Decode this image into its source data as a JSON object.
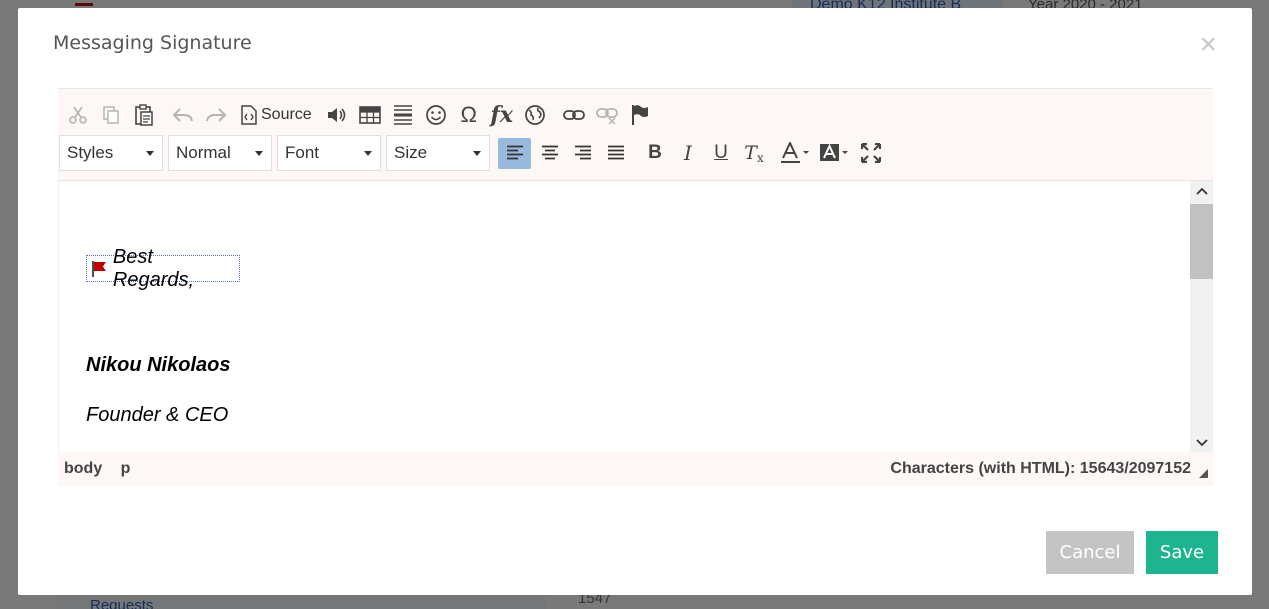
{
  "background": {
    "institute": "Demo K12 Institute B",
    "year": "Year 2020 - 2021",
    "sidebar_item": "Requests",
    "number": "1547"
  },
  "modal": {
    "title": "Messaging Signature",
    "close_symbol": "×"
  },
  "toolbar": {
    "source_label": "Source",
    "combos": {
      "styles": "Styles",
      "format": "Normal",
      "font": "Font",
      "size": "Size"
    },
    "active_alignment": "align-left"
  },
  "content": {
    "greeting": "Best Regards,",
    "name": "Nikou Nikolaos",
    "role": "Founder & CEO",
    "flag_color": "#c00000"
  },
  "statusbar": {
    "path": [
      "body",
      "p"
    ],
    "char_count": "Characters (with HTML): 15643/2097152"
  },
  "buttons": {
    "cancel": "Cancel",
    "save": "Save"
  },
  "colors": {
    "save": "#1db48f",
    "cancel": "#c4c4c4",
    "toolbar_bg": "#fdf7f6",
    "active_button": "#98b8dd"
  }
}
